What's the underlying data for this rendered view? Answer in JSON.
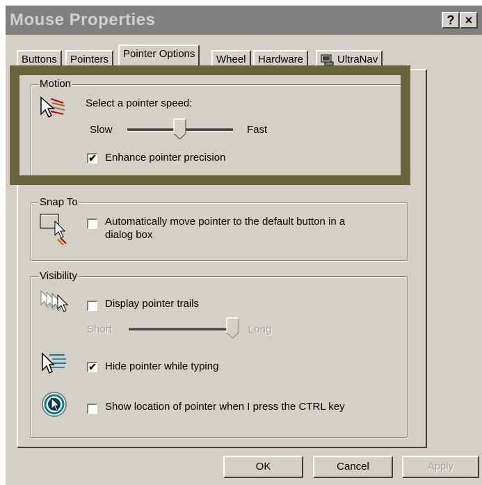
{
  "window": {
    "title": "Mouse Properties",
    "help_label": "?",
    "close_label": "×"
  },
  "tabs": [
    {
      "label": "Buttons"
    },
    {
      "label": "Pointers"
    },
    {
      "label": "Pointer Options"
    },
    {
      "label": "Wheel"
    },
    {
      "label": "Hardware"
    },
    {
      "label": "UltraNav"
    }
  ],
  "motion": {
    "group_label": "Motion",
    "speed_label": "Select a pointer speed:",
    "slow_label": "Slow",
    "fast_label": "Fast",
    "speed_value_fraction": 0.5,
    "enhance_label": "Enhance pointer precision",
    "enhance_checked": true
  },
  "snap_to": {
    "group_label": "Snap To",
    "auto_move_label_line1": "Automatically move pointer to the default button in a",
    "auto_move_label_line2": "dialog box",
    "auto_move_checked": false
  },
  "visibility": {
    "group_label": "Visibility",
    "trails_label": "Display pointer trails",
    "trails_checked": false,
    "short_label": "Short",
    "long_label": "Long",
    "trails_value_fraction": 1.0,
    "hide_label": "Hide pointer while typing",
    "hide_checked": true,
    "ctrl_label": "Show location of pointer when I press the CTRL key",
    "ctrl_checked": false
  },
  "buttons": {
    "ok": "OK",
    "cancel": "Cancel",
    "apply": "Apply"
  },
  "colors": {
    "highlight": "#67653a",
    "face": "#d4d0c8",
    "titlebar": "#808080"
  }
}
